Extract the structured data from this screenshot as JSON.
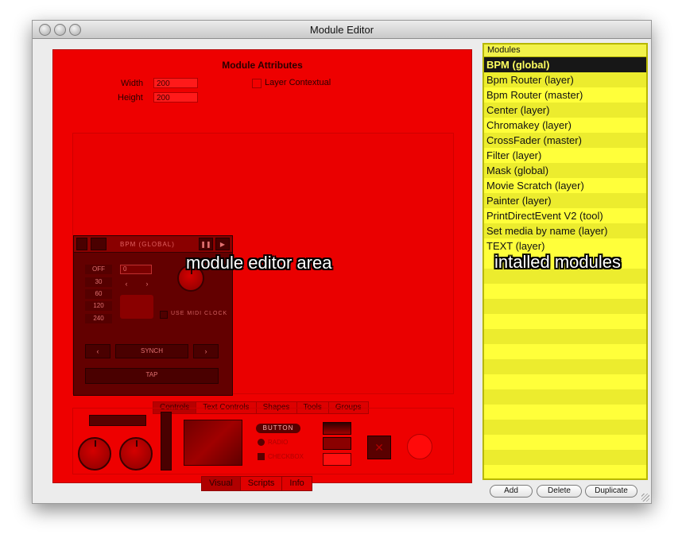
{
  "window": {
    "title": "Module Editor"
  },
  "attributes": {
    "title": "Module Attributes",
    "width_label": "Width",
    "width_value": "200",
    "height_label": "Height",
    "height_value": "200",
    "contextual_label": "Layer Contextual"
  },
  "module_preview": {
    "title": "BPM (GLOBAL)",
    "presets": [
      "OFF",
      "30",
      "60",
      "120",
      "240"
    ],
    "bpm_value": "0",
    "nav_prev": "‹",
    "nav_next": "›",
    "midi_label": "USE MIDI CLOCK",
    "synch_label": "SYNCH",
    "tap_label": "TAP"
  },
  "widget_tabs": [
    "Controls",
    "Text Controls",
    "Shapes",
    "Tools",
    "Groups"
  ],
  "widget_palette": {
    "button_label": "BUTTON",
    "radio_label": "RADIO",
    "checkbox_label": "CHECKBOX"
  },
  "editor_tabs": [
    "Visual",
    "Scripts",
    "Info"
  ],
  "annotations": {
    "editor": "module editor area",
    "modules": "intalled modules"
  },
  "modules": {
    "header": "Modules",
    "selected_index": 0,
    "items": [
      "BPM (global)",
      "Bpm Router (layer)",
      "Bpm Router (master)",
      "Center (layer)",
      "Chromakey (layer)",
      "CrossFader (master)",
      "Filter (layer)",
      "Mask (global)",
      "Movie Scratch (layer)",
      "Painter (layer)",
      "PrintDirectEvent V2 (tool)",
      "Set media by name (layer)",
      "TEXT (layer)"
    ]
  },
  "buttons": {
    "add": "Add",
    "delete": "Delete",
    "duplicate": "Duplicate"
  },
  "colors": {
    "editor_red": "#ee0000",
    "list_yellow": "#ffff40",
    "selected_row": "#171717"
  }
}
